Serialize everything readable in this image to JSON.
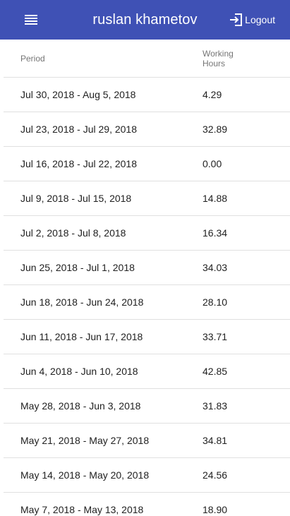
{
  "appbar": {
    "title": "ruslan khametov",
    "logout_label": "Logout",
    "color": "#3f51b5",
    "menu_icon": "menu-icon",
    "logout_icon": "logout-icon"
  },
  "table": {
    "headers": {
      "period": "Period",
      "hours_line1": "Working",
      "hours_line2": "Hours"
    },
    "rows": [
      {
        "period": "Jul 30, 2018 - Aug 5, 2018",
        "hours": "4.29"
      },
      {
        "period": "Jul 23, 2018 - Jul 29, 2018",
        "hours": "32.89"
      },
      {
        "period": "Jul 16, 2018 - Jul 22, 2018",
        "hours": "0.00"
      },
      {
        "period": "Jul 9, 2018 - Jul 15, 2018",
        "hours": "14.88"
      },
      {
        "period": "Jul 2, 2018 - Jul 8, 2018",
        "hours": "16.34"
      },
      {
        "period": "Jun 25, 2018 - Jul 1, 2018",
        "hours": "34.03"
      },
      {
        "period": "Jun 18, 2018 - Jun 24, 2018",
        "hours": "28.10"
      },
      {
        "period": "Jun 11, 2018 - Jun 17, 2018",
        "hours": "33.71"
      },
      {
        "period": "Jun 4, 2018 - Jun 10, 2018",
        "hours": "42.85"
      },
      {
        "period": "May 28, 2018 - Jun 3, 2018",
        "hours": "31.83"
      },
      {
        "period": "May 21, 2018 - May 27, 2018",
        "hours": "34.81"
      },
      {
        "period": "May 14, 2018 - May 20, 2018",
        "hours": "24.56"
      },
      {
        "period": "May 7, 2018 - May 13, 2018",
        "hours": "18.90"
      }
    ]
  }
}
